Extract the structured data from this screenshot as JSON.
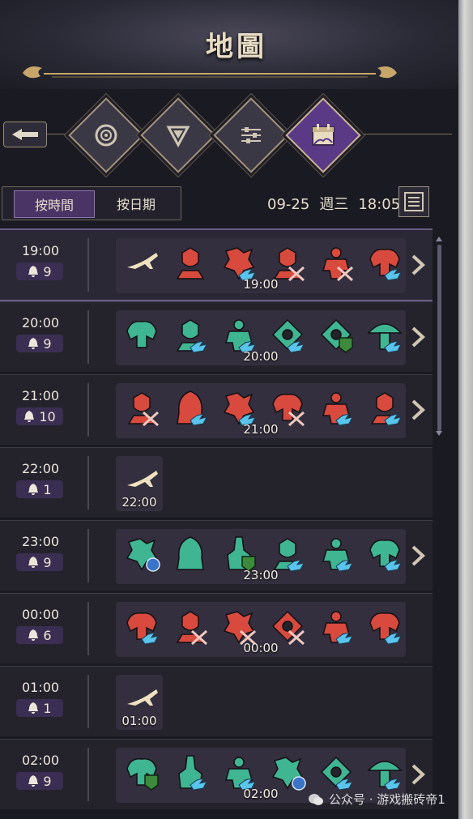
{
  "header": {
    "title": "地圖"
  },
  "nav": {
    "back_icon": "arrow-left-icon",
    "tabs": [
      {
        "name": "compass-icon",
        "active": false
      },
      {
        "name": "filter-icon",
        "active": false
      },
      {
        "name": "sliders-icon",
        "active": false
      },
      {
        "name": "calendar-icon",
        "active": true
      }
    ]
  },
  "view_tabs": {
    "by_time": "按時間",
    "by_date": "按日期",
    "active": "by_time"
  },
  "status": {
    "date": "09-25",
    "weekday": "週三",
    "time": "18:05"
  },
  "colors": {
    "red": "#d84a3e",
    "green": "#3fb592",
    "bird": "#59c4ec",
    "shield": "#3d8a3c",
    "accent": "#5a3a86"
  },
  "schedule": [
    {
      "time": "19:00",
      "count": "9",
      "panel_time": "19:00",
      "has_more": true,
      "icons": [
        [
          "beige",
          "plane"
        ],
        [
          "red",
          "bust"
        ],
        [
          "red",
          "dragon",
          "bird"
        ],
        [
          "red",
          "bust",
          "x"
        ],
        [
          "red",
          "golem",
          "x"
        ],
        [
          "red",
          "beast",
          "bird"
        ]
      ]
    },
    {
      "time": "20:00",
      "count": "9",
      "panel_time": "20:00",
      "has_more": true,
      "icons": [
        [
          "green",
          "beast"
        ],
        [
          "green",
          "bust",
          "bird"
        ],
        [
          "green",
          "golem",
          "bird"
        ],
        [
          "green",
          "eye",
          "bird"
        ],
        [
          "green",
          "eye",
          "shield"
        ],
        [
          "green",
          "mushroom",
          "bird"
        ]
      ]
    },
    {
      "time": "21:00",
      "count": "10",
      "panel_time": "21:00",
      "has_more": true,
      "icons": [
        [
          "red",
          "bust",
          "x"
        ],
        [
          "red",
          "hood",
          "bird"
        ],
        [
          "red",
          "dragon",
          "bird"
        ],
        [
          "red",
          "beast",
          "x"
        ],
        [
          "red",
          "golem",
          "bird"
        ],
        [
          "red",
          "bust",
          "bird"
        ]
      ]
    },
    {
      "time": "22:00",
      "count": "1",
      "panel_time": "22:00",
      "has_more": false,
      "icons": [
        [
          "beige",
          "plane"
        ]
      ]
    },
    {
      "time": "23:00",
      "count": "9",
      "panel_time": "23:00",
      "has_more": true,
      "icons": [
        [
          "green",
          "dragon",
          "orb"
        ],
        [
          "green",
          "hood"
        ],
        [
          "green",
          "knight",
          "shield"
        ],
        [
          "green",
          "bust",
          "bird"
        ],
        [
          "green",
          "golem",
          "bird"
        ],
        [
          "green",
          "beast",
          "bird"
        ]
      ]
    },
    {
      "time": "00:00",
      "count": "6",
      "panel_time": "00:00",
      "has_more": false,
      "icons": [
        [
          "red",
          "beast",
          "bird"
        ],
        [
          "red",
          "bust",
          "x"
        ],
        [
          "red",
          "dragon",
          "x"
        ],
        [
          "red",
          "eye",
          "x"
        ],
        [
          "red",
          "golem",
          "bird"
        ],
        [
          "red",
          "beast",
          "bird"
        ]
      ]
    },
    {
      "time": "01:00",
      "count": "1",
      "panel_time": "01:00",
      "has_more": false,
      "icons": [
        [
          "beige",
          "plane"
        ]
      ]
    },
    {
      "time": "02:00",
      "count": "9",
      "panel_time": "02:00",
      "has_more": true,
      "icons": [
        [
          "green",
          "beast",
          "shield"
        ],
        [
          "green",
          "knight",
          "bird"
        ],
        [
          "green",
          "golem",
          "bird"
        ],
        [
          "green",
          "dragon",
          "orb"
        ],
        [
          "green",
          "eye",
          "bird"
        ],
        [
          "green",
          "mushroom",
          "bird"
        ]
      ]
    }
  ],
  "watermark": "公众号 · 游戏搬砖帝1"
}
